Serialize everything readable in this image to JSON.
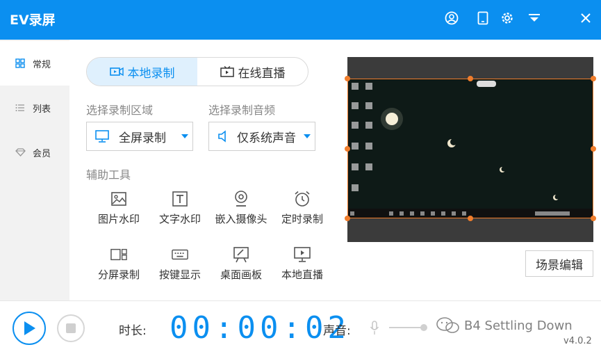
{
  "app": {
    "title": "EV录屏",
    "accent": "#0b8ff0",
    "version": "v4.0.2"
  },
  "titlebar_icons": [
    "user-icon",
    "tablet-icon",
    "gear-icon",
    "menu-icon",
    "close-icon"
  ],
  "sidebar": {
    "items": [
      {
        "label": "常规",
        "icon": "grid-icon",
        "active": true
      },
      {
        "label": "列表",
        "icon": "list-icon",
        "active": false
      },
      {
        "label": "会员",
        "icon": "diamond-icon",
        "active": false
      }
    ]
  },
  "tabs": [
    {
      "label": "本地录制",
      "icon": "video-icon",
      "active": true
    },
    {
      "label": "在线直播",
      "icon": "tv-icon",
      "active": false
    }
  ],
  "record_area": {
    "label": "选择录制区域",
    "value": "全屏录制"
  },
  "record_audio": {
    "label": "选择录制音频",
    "value": "仅系统声音"
  },
  "tools": {
    "label": "辅助工具",
    "items": [
      {
        "label": "图片水印",
        "icon": "image-icon"
      },
      {
        "label": "文字水印",
        "icon": "text-icon"
      },
      {
        "label": "嵌入摄像头",
        "icon": "webcam-icon"
      },
      {
        "label": "定时录制",
        "icon": "alarm-clock-icon"
      },
      {
        "label": "分屏录制",
        "icon": "split-screen-icon"
      },
      {
        "label": "按键显示",
        "icon": "keyboard-icon"
      },
      {
        "label": "桌面画板",
        "icon": "board-icon"
      },
      {
        "label": "本地直播",
        "icon": "monitor-play-icon"
      }
    ]
  },
  "preview": {
    "scene_button": "场景编辑"
  },
  "bottom": {
    "duration_label": "时长:",
    "timer": "00:00:02",
    "sound_label": "声音:",
    "watermark": "B4 Settling Down"
  }
}
